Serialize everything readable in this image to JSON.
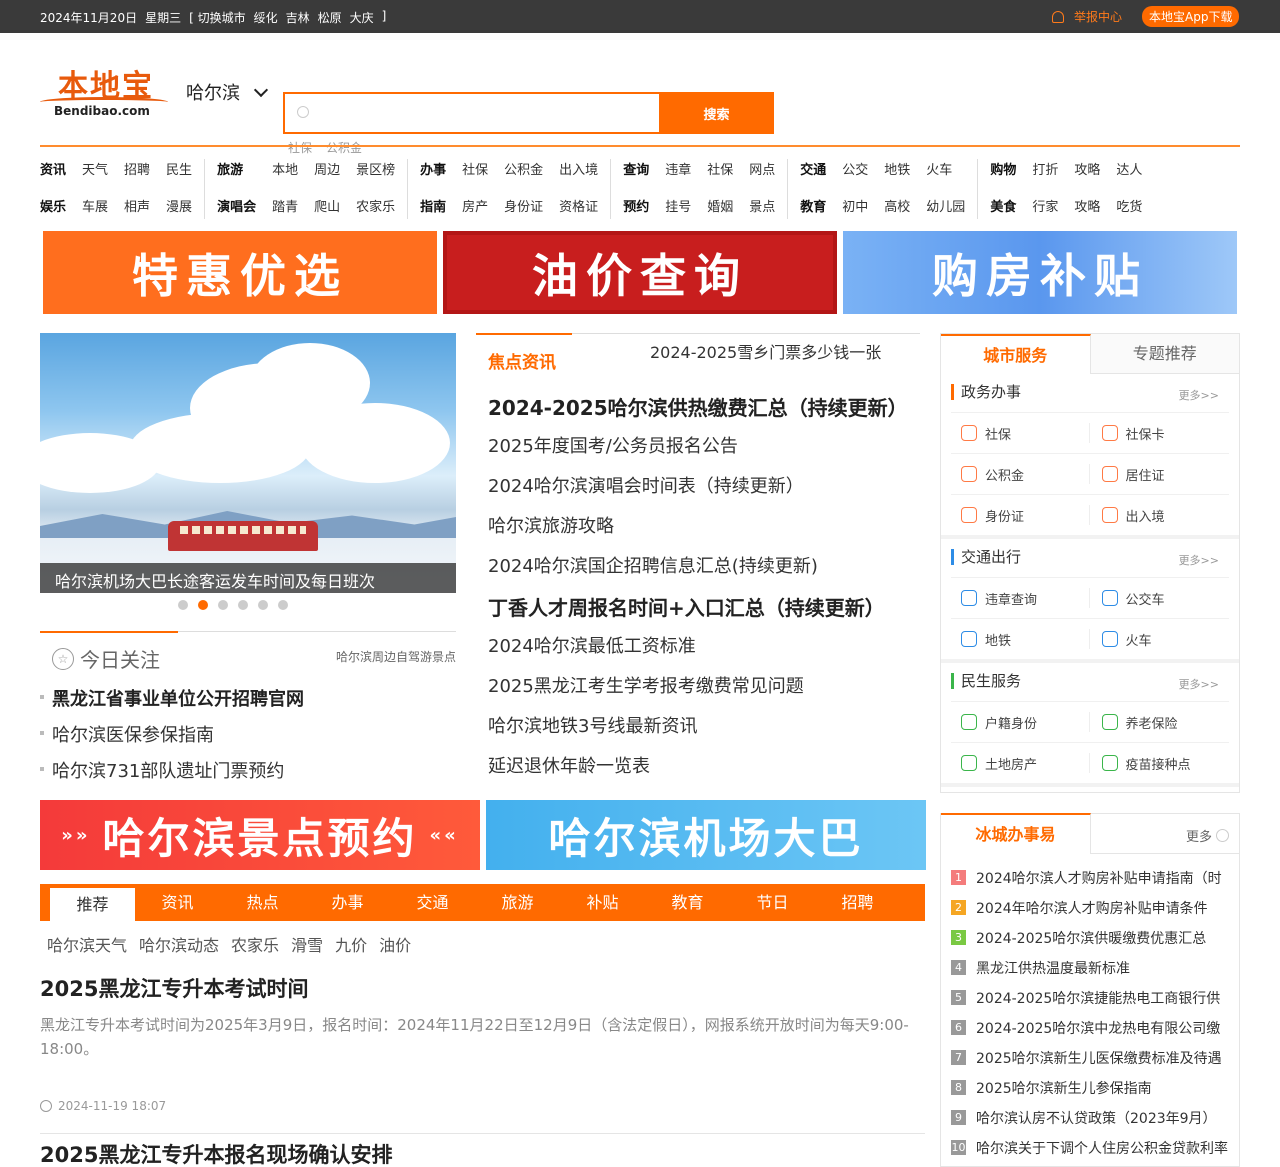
{
  "topbar": {
    "date": "2024年11月20日",
    "weekday": "星期三",
    "switch_label": "[ 切换城市",
    "cities": [
      "绥化",
      "吉林",
      "松原",
      "大庆"
    ],
    "bracket_close": "]",
    "report": "举报中心",
    "app": "本地宝App下载"
  },
  "header": {
    "logo_cn": "本地宝",
    "logo_en": "Bendibao.com",
    "city": "哈尔滨",
    "search_button": "搜索",
    "search_placeholder": "",
    "hotwords": [
      "社保",
      "公积金"
    ]
  },
  "nav": [
    [
      "资讯",
      "天气",
      "招聘",
      "民生",
      "娱乐",
      "车展",
      "相声",
      "漫展"
    ],
    [
      "旅游",
      "本地",
      "周边",
      "景区榜",
      "演唱会",
      "踏青",
      "爬山",
      "农家乐"
    ],
    [
      "办事",
      "社保",
      "公积金",
      "出入境",
      "指南",
      "房产",
      "身份证",
      "资格证"
    ],
    [
      "查询",
      "违章",
      "社保",
      "网点",
      "预约",
      "挂号",
      "婚姻",
      "景点"
    ],
    [
      "交通",
      "公交",
      "地铁",
      "火车",
      "教育",
      "初中",
      "高校",
      "幼儿园"
    ],
    [
      "购物",
      "打折",
      "攻略",
      "达人",
      "美食",
      "行家",
      "攻略",
      "吃货"
    ]
  ],
  "banners": [
    "特惠优选",
    "油价查询",
    "购房补贴"
  ],
  "slider": {
    "caption": "哈尔滨机场大巴长途客运发车时间及每日班次",
    "dots": 6,
    "active": 2
  },
  "today": {
    "title": "今日关注",
    "right": "哈尔滨周边自驾游景点",
    "items": [
      "黑龙江省事业单位公开招聘官网",
      "哈尔滨医保参保指南",
      "哈尔滨731部队遗址门票预约"
    ]
  },
  "news": {
    "title": "焦点资讯",
    "top": "2024-2025雪乡门票多少钱一张",
    "items": [
      "2024-2025哈尔滨供热缴费汇总（持续更新）",
      "2025年度国考/公务员报名公告",
      "2024哈尔滨演唱会时间表（持续更新）",
      "哈尔滨旅游攻略",
      "2024哈尔滨国企招聘信息汇总(持续更新)",
      "丁香人才周报名时间+入口汇总（持续更新）",
      "2024哈尔滨最低工资标准",
      "2025黑龙江考生学考报考缴费常见问题",
      "哈尔滨地铁3号线最新资讯",
      "延迟退休年龄一览表"
    ]
  },
  "services": {
    "tabs": [
      "城市服务",
      "专题推荐"
    ],
    "more": "更多>>",
    "sections": [
      {
        "name": "政务办事",
        "items": [
          "社保",
          "社保卡",
          "公积金",
          "居住证",
          "身份证",
          "出入境"
        ]
      },
      {
        "name": "交通出行",
        "items": [
          "违章查询",
          "公交车",
          "地铁",
          "火车"
        ]
      },
      {
        "name": "民生服务",
        "items": [
          "户籍身份",
          "养老保险",
          "土地房产",
          "疫苗接种点"
        ]
      }
    ]
  },
  "banners2": [
    "哈尔滨景点预约",
    "哈尔滨机场大巴"
  ],
  "tabs": [
    "推荐",
    "资讯",
    "热点",
    "办事",
    "交通",
    "旅游",
    "补贴",
    "教育",
    "节日",
    "招聘"
  ],
  "subtags": [
    "哈尔滨天气",
    "哈尔滨动态",
    "农家乐",
    "滑雪",
    "九价",
    "油价"
  ],
  "articles": [
    {
      "title": "2025黑龙江专升本考试时间",
      "desc": "黑龙江专升本考试时间为2025年3月9日，报名时间：2024年11月22日至12月9日（含法定假日），网报系统开放时间为每天9:00-18:00。",
      "time": "2024-11-19 18:07"
    },
    {
      "title": "2025黑龙江专升本报名现场确认安排",
      "desc": "",
      "time": ""
    }
  ],
  "ice": {
    "title": "冰城办事易",
    "more": "更多",
    "items": [
      "2024哈尔滨人才购房补贴申请指南（时",
      "2024年哈尔滨人才购房补贴申请条件",
      "2024-2025哈尔滨供暖缴费优惠汇总",
      "黑龙江供热温度最新标准",
      "2024-2025哈尔滨捷能热电工商银行供",
      "2024-2025哈尔滨中龙热电有限公司缴",
      "2025哈尔滨新生儿医保缴费标准及待遇",
      "2025哈尔滨新生儿参保指南",
      "哈尔滨认房不认贷政策（2023年9月）",
      "哈尔滨关于下调个人住房公积金贷款利率"
    ],
    "numbers": [
      "1",
      "2",
      "3",
      "4",
      "5",
      "6",
      "7",
      "8",
      "9",
      "10"
    ],
    "colors": [
      "#f47c7c",
      "#f5a623",
      "#7ac943",
      "#999999"
    ]
  }
}
